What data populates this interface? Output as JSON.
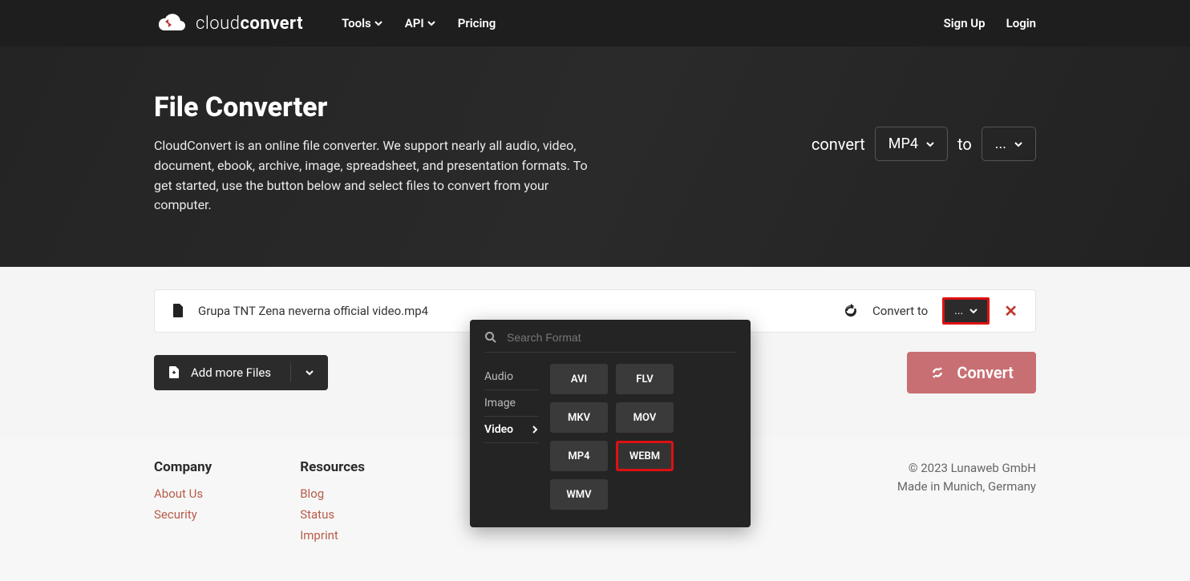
{
  "brand": {
    "light": "cloud",
    "bold": "convert"
  },
  "nav": {
    "tools": "Tools",
    "api": "API",
    "pricing": "Pricing",
    "signup": "Sign Up",
    "login": "Login"
  },
  "hero": {
    "title": "File Converter",
    "desc": "CloudConvert is an online file converter. We support nearly all audio, video, document, ebook, archive, image, spreadsheet, and presentation formats. To get started, use the button below and select files to convert from your computer."
  },
  "convertBar": {
    "convert": "convert",
    "from": "MP4",
    "to": "to",
    "target": "..."
  },
  "file": {
    "name": "Grupa TNT Zena neverna official video.mp4",
    "convert_to": "Convert to",
    "trigger": "..."
  },
  "dropdown": {
    "search_placeholder": "Search Format",
    "categories": {
      "audio": "Audio",
      "image": "Image",
      "video": "Video"
    },
    "formats": [
      "AVI",
      "FLV",
      "MKV",
      "MOV",
      "MP4",
      "WEBM",
      "WMV"
    ],
    "highlight": "WEBM"
  },
  "actions": {
    "add_more": "Add more Files",
    "convert": "Convert"
  },
  "footer": {
    "company": {
      "title": "Company",
      "about": "About Us",
      "security": "Security"
    },
    "resources": {
      "title": "Resources",
      "blog": "Blog",
      "status": "Status",
      "imprint": "Imprint"
    },
    "copyright": "© 2023 Lunaweb GmbH",
    "location": "Made in Munich, Germany"
  }
}
